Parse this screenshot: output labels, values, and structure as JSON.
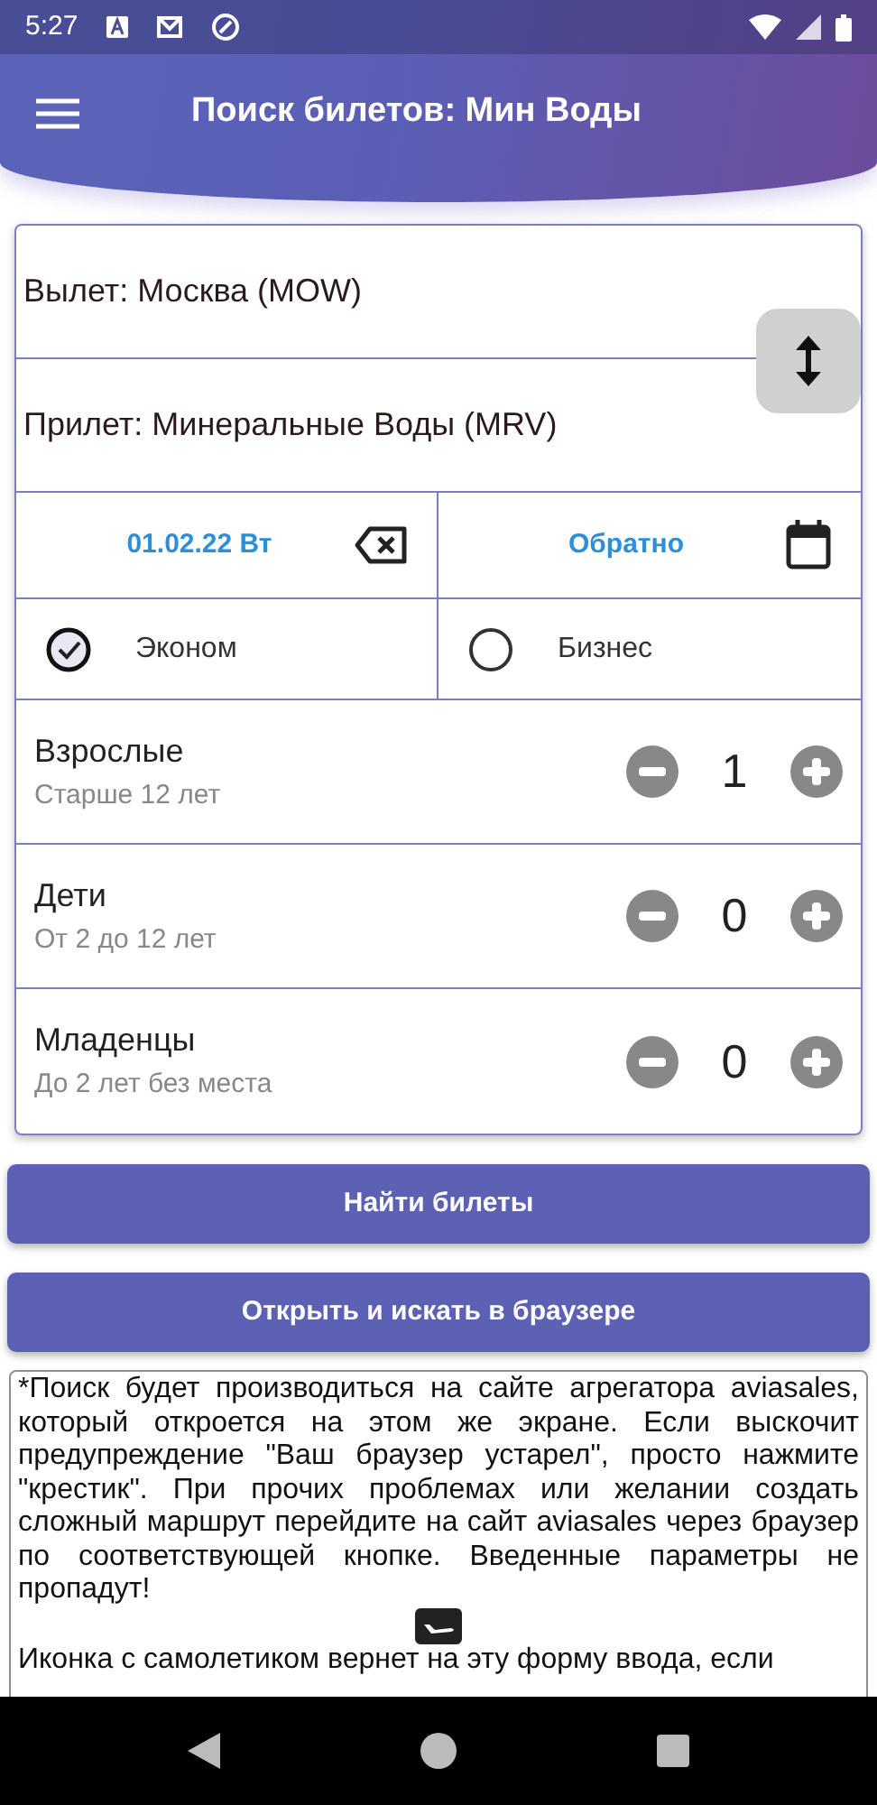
{
  "status_bar": {
    "time": "5:27"
  },
  "app_bar": {
    "title": "Поиск билетов: Мин Воды"
  },
  "route": {
    "departure": "Вылет: Москва (MOW)",
    "arrival": "Прилет: Минеральные Воды (MRV)"
  },
  "dates": {
    "departure": "01.02.22 Вт",
    "return": "Обратно"
  },
  "classes": [
    {
      "label": "Эконом",
      "selected": true
    },
    {
      "label": "Бизнес",
      "selected": false
    }
  ],
  "passengers": [
    {
      "title": "Взрослые",
      "subtitle": "Старше 12 лет",
      "count": "1"
    },
    {
      "title": "Дети",
      "subtitle": "От 2 до 12 лет",
      "count": "0"
    },
    {
      "title": "Младенцы",
      "subtitle": "До 2 лет без места",
      "count": "0"
    }
  ],
  "buttons": [
    "Найти билеты",
    "Открыть и искать в браузере"
  ],
  "info": {
    "text": "*Поиск будет производиться на сайте агрегатора aviasales, который откроется на этом же экране. Если выскочит предупреждение \"Ваш браузер устарел\", просто нажмите \"крестик\". При прочих проблемах или желании создать сложный маршрут перейдите на сайт aviasales через браузер по соответствующей кнопке. Введенные параметры не пропадут!",
    "continuation": "Иконка с самолетиком вернет на эту форму ввода, если"
  }
}
